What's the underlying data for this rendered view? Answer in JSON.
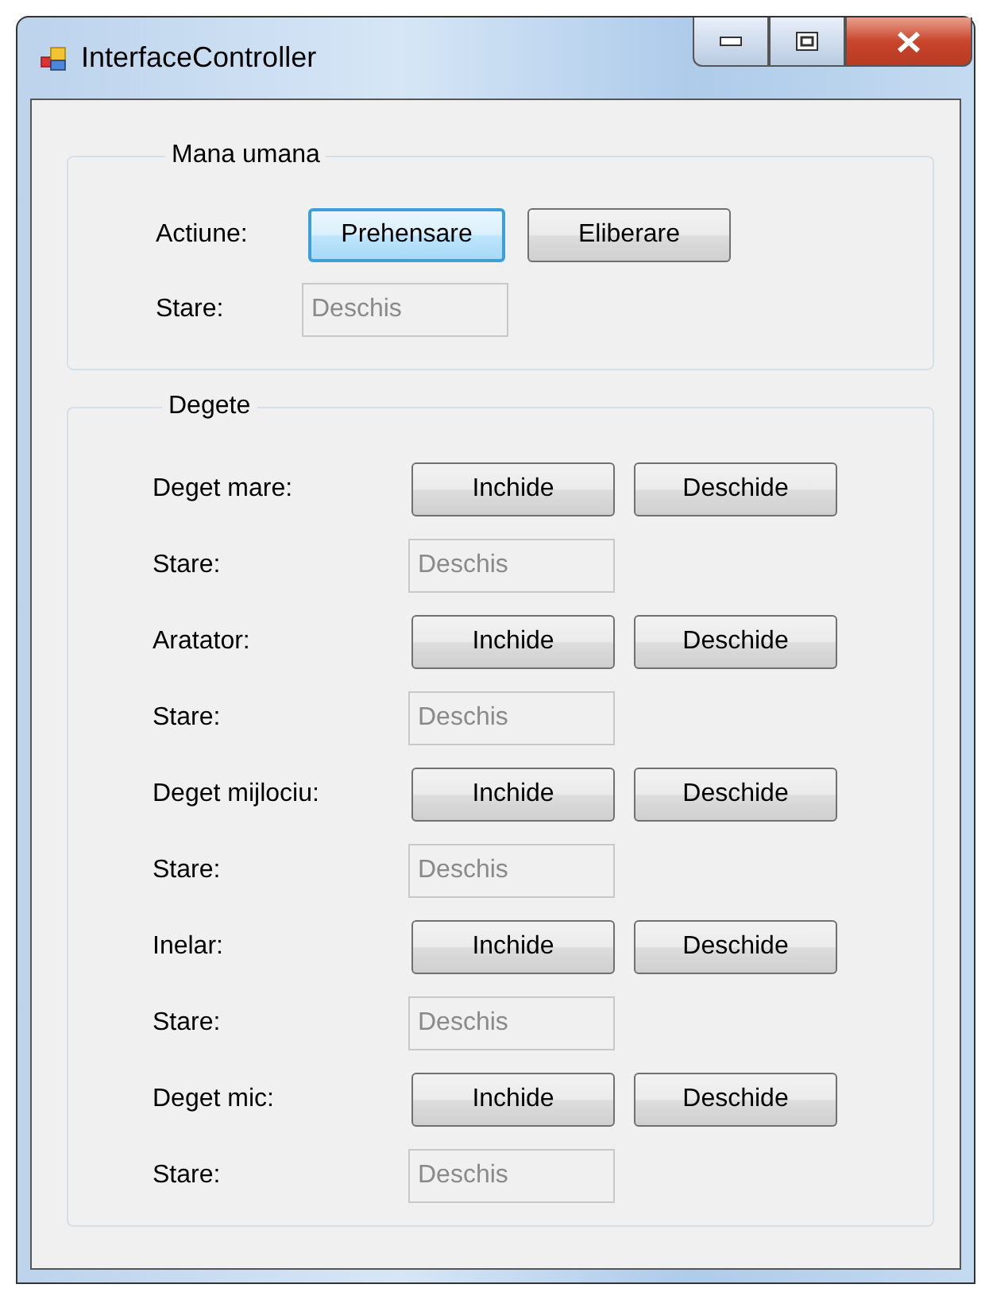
{
  "window": {
    "title": "InterfaceController"
  },
  "groups": [
    {
      "title": "Mana umana",
      "rows": [
        {
          "kind": "buttons",
          "label": "Actiune:",
          "buttons": [
            {
              "label": "Prehensare",
              "focused": true
            },
            {
              "label": "Eliberare",
              "focused": false
            }
          ]
        },
        {
          "kind": "field",
          "label": "Stare:",
          "value": "Deschis",
          "disabled": true
        }
      ]
    },
    {
      "title": "Degete",
      "rows": [
        {
          "kind": "buttons",
          "label": "Deget mare:",
          "buttons": [
            {
              "label": "Inchide",
              "focused": false
            },
            {
              "label": "Deschide",
              "focused": false
            }
          ]
        },
        {
          "kind": "field",
          "label": "Stare:",
          "value": "Deschis",
          "disabled": true
        },
        {
          "kind": "buttons",
          "label": "Aratator:",
          "buttons": [
            {
              "label": "Inchide",
              "focused": false
            },
            {
              "label": "Deschide",
              "focused": false
            }
          ]
        },
        {
          "kind": "field",
          "label": "Stare:",
          "value": "Deschis",
          "disabled": true
        },
        {
          "kind": "buttons",
          "label": "Deget mijlociu:",
          "buttons": [
            {
              "label": "Inchide",
              "focused": false
            },
            {
              "label": "Deschide",
              "focused": false
            }
          ]
        },
        {
          "kind": "field",
          "label": "Stare:",
          "value": "Deschis",
          "disabled": true
        },
        {
          "kind": "buttons",
          "label": "Inelar:",
          "buttons": [
            {
              "label": "Inchide",
              "focused": false
            },
            {
              "label": "Deschide",
              "focused": false
            }
          ]
        },
        {
          "kind": "field",
          "label": "Stare:",
          "value": "Deschis",
          "disabled": true
        },
        {
          "kind": "buttons",
          "label": "Deget mic:",
          "buttons": [
            {
              "label": "Inchide",
              "focused": false
            },
            {
              "label": "Deschide",
              "focused": false
            }
          ]
        },
        {
          "kind": "field",
          "label": "Stare:",
          "value": "Deschis",
          "disabled": true
        }
      ]
    }
  ]
}
